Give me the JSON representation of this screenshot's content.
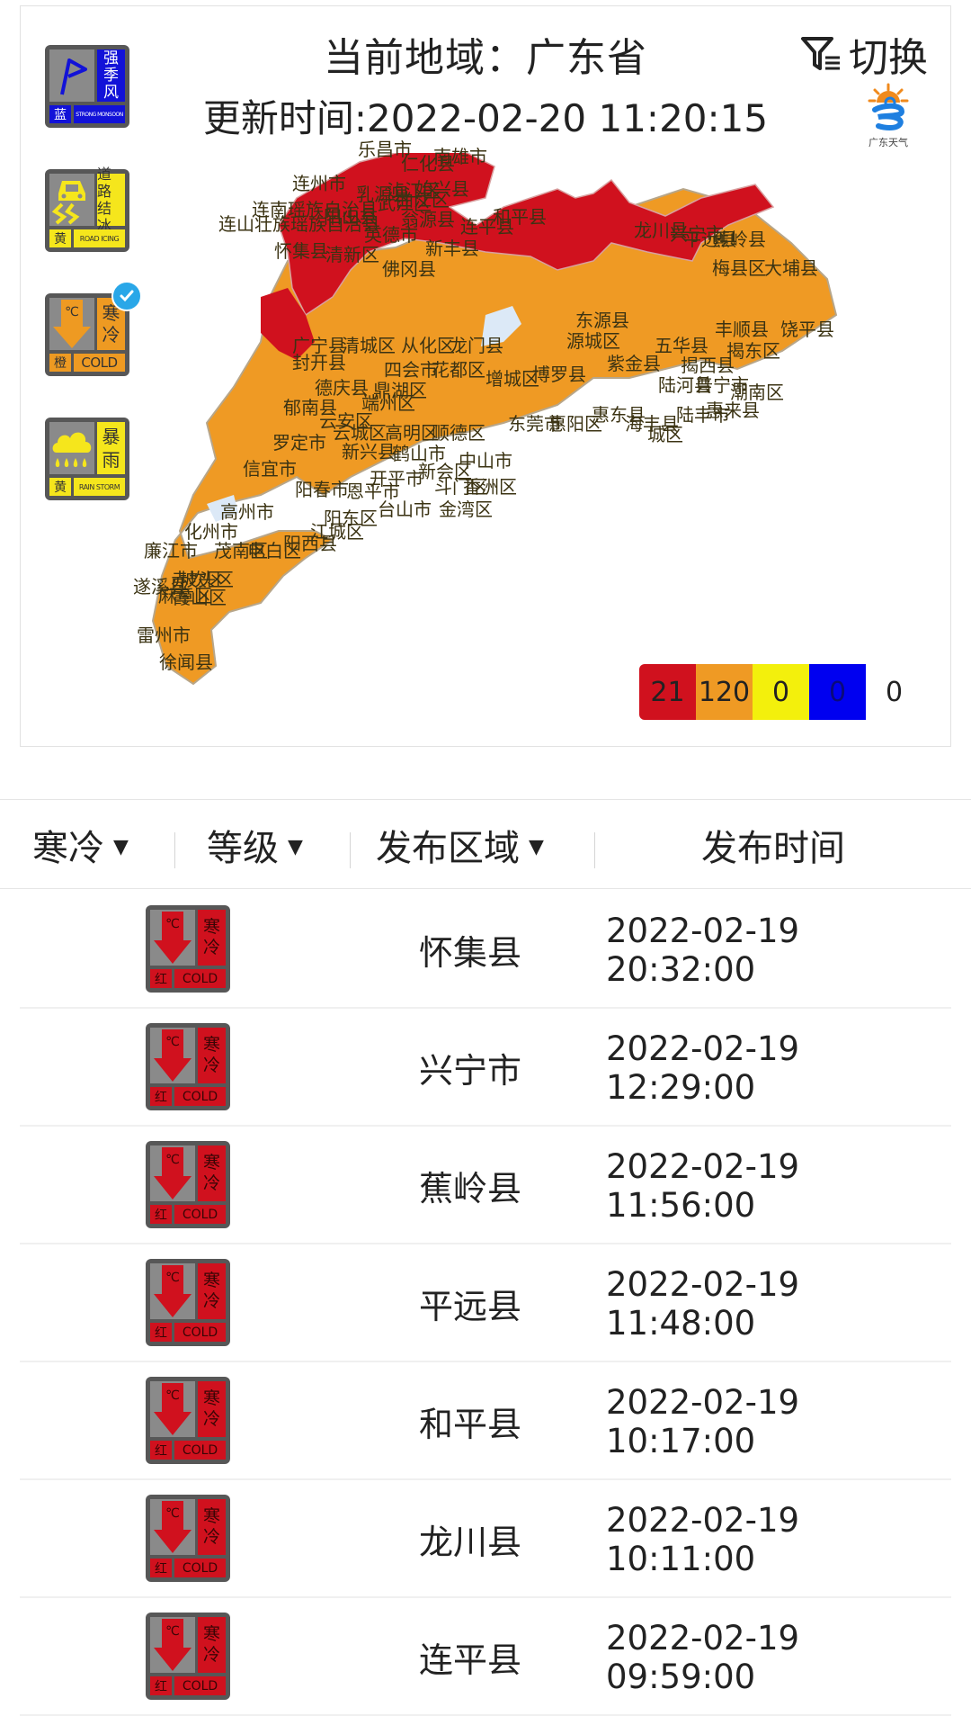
{
  "header": {
    "region_label": "当前地域：广东省",
    "update_time": "更新时间:2022-02-20 11:20:15",
    "switch_label": "切换",
    "logo_text": "广东天气"
  },
  "warning_types": [
    {
      "name_lines": [
        "强",
        "季",
        "风"
      ],
      "level": "蓝",
      "en": "STRONG MONSOON",
      "color": "#1212d8",
      "selected": false
    },
    {
      "name_lines": [
        "道路",
        "结冰"
      ],
      "level": "黄",
      "en": "ROAD ICING",
      "color": "#f5e61c",
      "selected": false
    },
    {
      "name_lines": [
        "寒",
        "冷"
      ],
      "level": "橙",
      "en": "COLD",
      "color": "#ee9a22",
      "selected": true
    },
    {
      "name_lines": [
        "暴",
        "雨"
      ],
      "level": "黄",
      "en": "RAIN STORM",
      "color": "#f5e61c",
      "selected": false
    }
  ],
  "legend": [
    {
      "level": "red",
      "color": "#d0111e",
      "count": "21"
    },
    {
      "level": "orange",
      "color": "#ef9a24",
      "count": "120"
    },
    {
      "level": "yellow",
      "color": "#f3f00c",
      "count": "0"
    },
    {
      "level": "blue",
      "color": "#0000f0",
      "count": "0"
    },
    {
      "level": "none",
      "color": "#ffffff",
      "count": "0"
    }
  ],
  "map_labels": [
    "乐昌市",
    "南雄市",
    "仁化县",
    "连州市",
    "乳源县",
    "浈江区",
    "始兴县",
    "武江区",
    "曲江区",
    "连南瑶族自治县",
    "阳山县",
    "连山壮族瑶族自治县",
    "翁源县",
    "英德市",
    "连平县",
    "和平县",
    "平远县",
    "蕉岭县",
    "怀集县",
    "清新区",
    "佛冈县",
    "新丰县",
    "龙川县",
    "兴宁市",
    "梅县区",
    "大埔县",
    "东源县",
    "广宁县",
    "清城区",
    "从化区",
    "龙门县",
    "源城区",
    "五华县",
    "丰顺县",
    "饶平县",
    "封开县",
    "四会市",
    "花都区",
    "增城区",
    "博罗县",
    "紫金县",
    "揭西县",
    "揭东区",
    "德庆县",
    "鼎湖区",
    "端州区",
    "郁南县",
    "云安区",
    "云城区",
    "陆河县",
    "普宁市",
    "潮南区",
    "罗定市",
    "高明区",
    "顺德区",
    "新兴县",
    "鹤山市",
    "东莞市",
    "惠阳区",
    "惠东县",
    "海丰县",
    "陆丰市",
    "惠来县",
    "城区",
    "信宜市",
    "阳春市",
    "恩平市",
    "开平市",
    "新会区",
    "斗门区",
    "香洲区",
    "中山市",
    "高州市",
    "阳东区",
    "台山市",
    "金湾区",
    "化州市",
    "江城区",
    "廉江市",
    "茂南区",
    "电白区",
    "阳西县",
    "遂溪县",
    "赤坎区",
    "坡头区",
    "麻章区",
    "霞山区",
    "雷州市",
    "徐闻县"
  ],
  "table": {
    "columns": [
      {
        "label": "寒冷",
        "dropdown": true
      },
      {
        "label": "等级",
        "dropdown": true
      },
      {
        "label": "发布区域",
        "dropdown": true
      },
      {
        "label": "发布时间",
        "dropdown": false
      }
    ],
    "rows": [
      {
        "type": "寒冷",
        "level": "红",
        "badge_en": "COLD",
        "area": "怀集县",
        "time": "2022-02-19 20:32:00"
      },
      {
        "type": "寒冷",
        "level": "红",
        "badge_en": "COLD",
        "area": "兴宁市",
        "time": "2022-02-19 12:29:00"
      },
      {
        "type": "寒冷",
        "level": "红",
        "badge_en": "COLD",
        "area": "蕉岭县",
        "time": "2022-02-19 11:56:00"
      },
      {
        "type": "寒冷",
        "level": "红",
        "badge_en": "COLD",
        "area": "平远县",
        "time": "2022-02-19 11:48:00"
      },
      {
        "type": "寒冷",
        "level": "红",
        "badge_en": "COLD",
        "area": "和平县",
        "time": "2022-02-19 10:17:00"
      },
      {
        "type": "寒冷",
        "level": "红",
        "badge_en": "COLD",
        "area": "龙川县",
        "time": "2022-02-19 10:11:00"
      },
      {
        "type": "寒冷",
        "level": "红",
        "badge_en": "COLD",
        "area": "连平县",
        "time": "2022-02-19 09:59:00"
      }
    ]
  },
  "badge_text": {
    "celsius": "℃",
    "cold_line1": "寒",
    "cold_line2": "冷"
  }
}
